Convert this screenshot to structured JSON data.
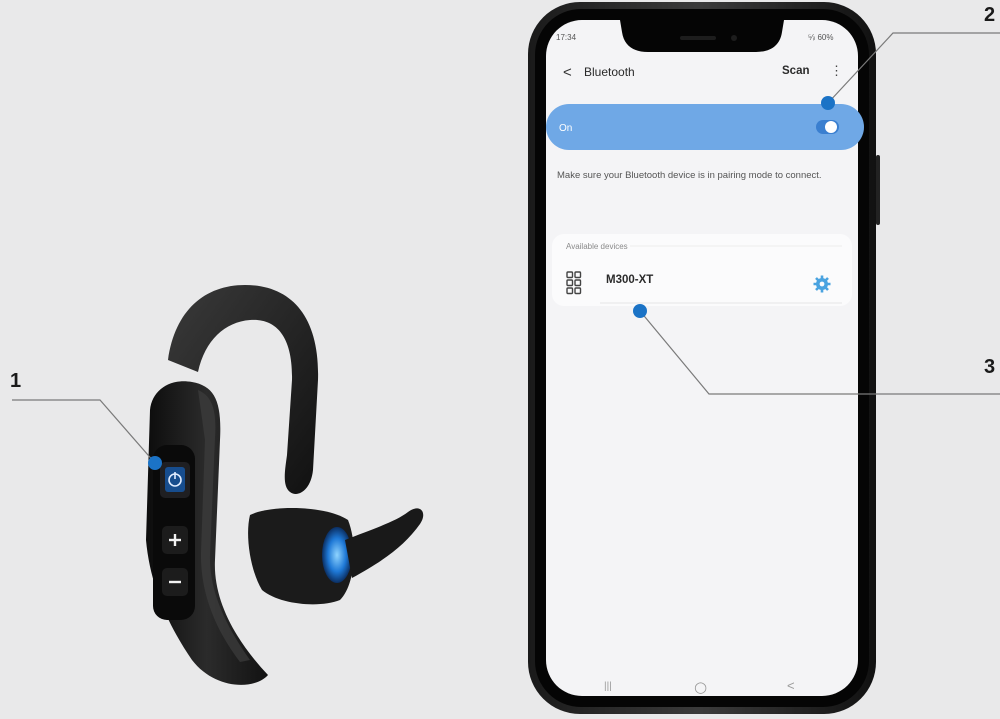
{
  "callouts": {
    "one": "1",
    "two": "2",
    "three": "3"
  },
  "phone": {
    "status": {
      "time": "17:34",
      "right": "⁵⁄ᵢₗ 60%"
    },
    "header": {
      "back_glyph": "<",
      "title": "Bluetooth",
      "scan_label": "Scan",
      "more_glyph": "⋮"
    },
    "toggle": {
      "label": "On",
      "state": "on"
    },
    "hint": "Make sure your Bluetooth device is in pairing mode to connect.",
    "available_devices": {
      "title": "Available devices",
      "items": [
        {
          "name": "M300-XT"
        }
      ]
    },
    "nav": {
      "recent_glyph": "|||",
      "home_glyph": "○",
      "back_glyph": "<"
    }
  },
  "colors": {
    "callout_dot": "#1b73c6",
    "bt_accent": "#6fa8e6",
    "gear": "#4aa3e0",
    "background": "#e9e9ea"
  }
}
